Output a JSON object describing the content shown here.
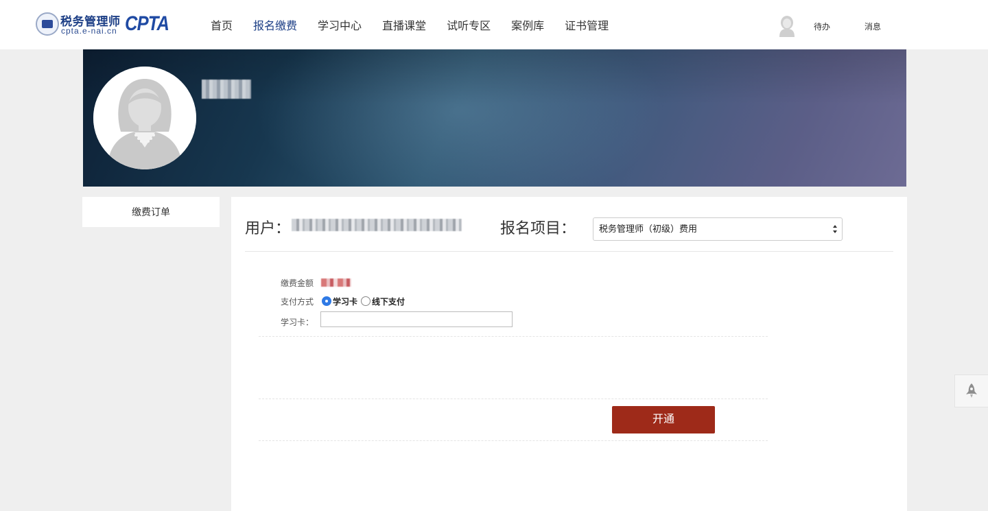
{
  "header": {
    "logo": {
      "cn_text": "税务管理师",
      "url_text": "cpta.e-nai.cn",
      "brand": "CPTA"
    },
    "nav": [
      {
        "label": "首页",
        "active": false
      },
      {
        "label": "报名缴费",
        "active": true
      },
      {
        "label": "学习中心",
        "active": false
      },
      {
        "label": "直播课堂",
        "active": false
      },
      {
        "label": "试听专区",
        "active": false
      },
      {
        "label": "案例库",
        "active": false
      },
      {
        "label": "证书管理",
        "active": false
      }
    ],
    "todo_label": "待办",
    "message_label": "消息"
  },
  "sidebar": {
    "items": [
      {
        "label": "缴费订单"
      }
    ]
  },
  "main": {
    "user_label": "用户：",
    "project_label": "报名项目：",
    "project_selected": "税务管理师（初级）费用",
    "form": {
      "amount_label": "缴费金额",
      "payment_label": "支付方式",
      "payment_options": [
        {
          "label": "学习卡",
          "checked": true
        },
        {
          "label": "线下支付",
          "checked": false
        }
      ],
      "card_label": "学习卡："
    },
    "submit_label": "开通"
  },
  "colors": {
    "nav_active": "#1d3f86",
    "submit_bg": "#9e2a19",
    "radio_checked": "#2f7ae5"
  },
  "icons": {
    "user_avatar": "female-avatar-icon",
    "select_arrows": "updown-arrows-icon",
    "back_to_top": "rocket-icon"
  }
}
